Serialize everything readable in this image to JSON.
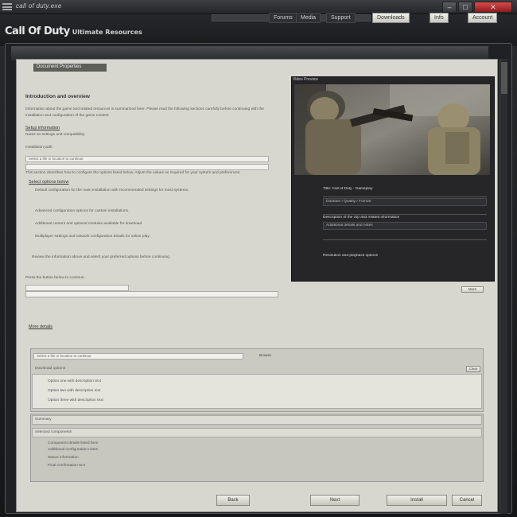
{
  "window": {
    "title": "call of duty.exe"
  },
  "header": {
    "logo_main": "Call Of Duty",
    "logo_sub": "Ultimate Resources",
    "nav": [
      "Forums",
      "Media",
      "Support",
      "Downloads",
      "Info",
      "Account"
    ]
  },
  "page": {
    "tab_label": "Document Properties",
    "doc_title": "Introduction and overview",
    "paragraphs": [
      "Information about the game and related resources is summarized here. Please read the following sections carefully before continuing with the installation and configuration of the game content.",
      "Notes on settings and compatibility.",
      "This section describes how to configure the options listed below. Adjust the values as required for your system and preferences."
    ],
    "heading_setup": "Setup information",
    "field_label": "Installation path",
    "options_heading": "Select options below",
    "bullets": [
      "Default configuration for the main installation with recommended settings for most systems.",
      "Advanced configuration options for custom installations.",
      "Additional content and optional modules available for download.",
      "Multiplayer settings and network configuration details for online play."
    ],
    "summary": "Review the information above and select your preferred options before continuing.",
    "final_note": "Press the button below to continue.",
    "details_link": "More details"
  },
  "video": {
    "label": "Video Preview",
    "info_rows": [
      "Title: Call of Duty - Gameplay",
      "Duration / Quality / Format",
      "Description of the clip and related information",
      "Additional details and notes",
      "Resolution and playback options"
    ],
    "more_label": "More"
  },
  "subpanel": {
    "field_value": "Select a file or location to continue",
    "browse_label": "Browse",
    "group_title": "Download options",
    "items": [
      "Option one with description text",
      "Option two with description text",
      "Option three with description text"
    ],
    "clear_label": "Clear"
  },
  "subpanel2": {
    "row1": "Summary",
    "row2": "Selected components",
    "lines": [
      "Component details listed here",
      "Additional configuration notes",
      "Status information",
      "Final confirmation text"
    ]
  },
  "buttons": {
    "back": "Back",
    "next": "Next",
    "install": "Install",
    "cancel": "Cancel"
  }
}
